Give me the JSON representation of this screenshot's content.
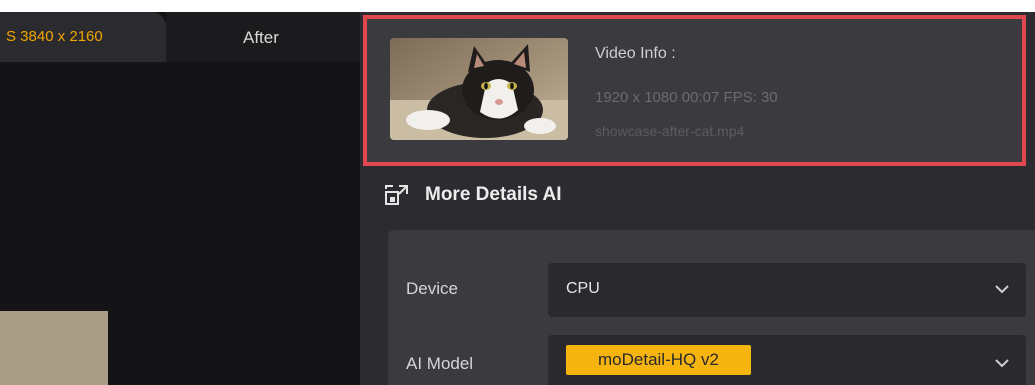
{
  "preview": {
    "before_tab_label": "S  3840 x 2160",
    "after_tab_label": "After"
  },
  "video_info": {
    "title": "Video Info :",
    "meta": "1920 x 1080  00:07    FPS: 30",
    "filename": "showcase-after-cat.mp4",
    "thumbnail_icon": "cat-photo-thumbnail"
  },
  "section": {
    "icon": "expand-window-icon",
    "title": "More Details AI"
  },
  "settings": {
    "device_label": "Device",
    "device_value": "CPU",
    "model_label": "AI Model",
    "model_value": "moDetail-HQ  v2"
  },
  "colors": {
    "accent": "#f5b40f",
    "highlight_border": "#e0474e",
    "before_label": "#f0a500"
  }
}
